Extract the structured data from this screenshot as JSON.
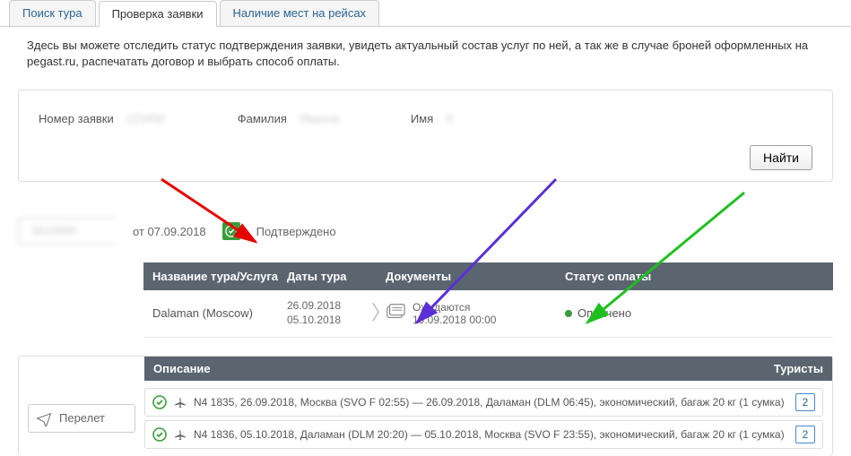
{
  "tabs": {
    "search": "Поиск тура",
    "check": "Проверка заявки",
    "seats": "Наличие мест на рейсах"
  },
  "description": "Здесь вы можете отследить статус подтверждения заявки, увидеть актуальный состав услуг по ней, а так же в случае броней оформленных на pegast.ru, распечатать договор и выбрать способ оплаты.",
  "search": {
    "booking_label": "Номер заявки",
    "lastname_label": "Фамилия",
    "firstname_label": "Имя",
    "booking_value": "123456",
    "lastname_value": "Иванов",
    "firstname_value": "К.",
    "find_label": "Найти"
  },
  "status": {
    "booking_number": "3610885",
    "date_prefix": "от",
    "date": "07.09.2018",
    "confirmed": "Подтверждено"
  },
  "columns": {
    "name": "Название тура/Услуга",
    "dates": "Даты тура",
    "docs": "Документы",
    "payment": "Статус оплаты"
  },
  "tour": {
    "name": "Dalaman (Moscow)",
    "date_from": "26.09.2018",
    "date_to": "05.10.2018",
    "docs_status": "Ожидаются",
    "docs_date": "19.09.2018 00:00",
    "pay_status": "Оплачено"
  },
  "flights": {
    "section_label": "Перелет",
    "header_left": "Описание",
    "header_right": "Туристы",
    "rows": [
      {
        "text": "N4 1835, 26.09.2018, Москва (SVO F 02:55) — 26.09.2018, Даламан (DLM 06:45), экономический, багаж 20 кг (1 сумка)",
        "pax": "2"
      },
      {
        "text": "N4 1836, 05.10.2018, Даламан (DLM 20:20) — 05.10.2018, Москва (SVO F 23:55), экономический, багаж 20 кг (1 сумка)",
        "pax": "2"
      }
    ]
  }
}
